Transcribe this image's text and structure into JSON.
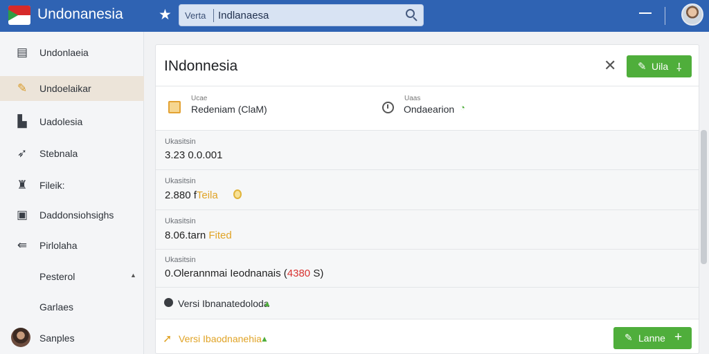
{
  "header": {
    "app_title": "Undonanesia",
    "search_prefix": "Verta",
    "search_value": "Indlanaesa",
    "icons": [
      "flag-icon",
      "star-icon",
      "search-icon",
      "minimize-icon",
      "avatar"
    ]
  },
  "sidebar": {
    "items": [
      {
        "label": "Undonlaeia",
        "icon": "inbox-icon"
      },
      {
        "label": "Undoelaikar",
        "icon": "pencil-icon",
        "active": true
      },
      {
        "label": "Uadolesia",
        "icon": "bookmark-icon"
      },
      {
        "label": "Stebnala",
        "icon": "wrench-icon"
      },
      {
        "label": "Fileik:",
        "icon": "puzzle-icon"
      },
      {
        "label": "Daddonsiohsighs",
        "icon": "clipboard-icon"
      },
      {
        "label": "Pirlolaha",
        "icon": "share-icon"
      },
      {
        "label": "Pesterol",
        "icon": ""
      },
      {
        "label": "Garlaes",
        "icon": ""
      },
      {
        "label": "Sanples",
        "icon": "avatar"
      }
    ]
  },
  "main": {
    "title": "INdonnesia",
    "edit_button": "Uila",
    "info": {
      "left_caption": "Ucae",
      "left_value": "Redeniam (ClaM)",
      "right_caption": "Uaas",
      "right_value": "Ondaearion"
    },
    "rows": [
      {
        "caption": "Ukasitsin",
        "value": "3.23 0.0.001",
        "tag": ""
      },
      {
        "caption": "Ukasitsin",
        "value": "2.880 f",
        "tag": "Teila"
      },
      {
        "caption": "Ukasitsin",
        "value": "8.06.tarn",
        "tag": "Fited"
      },
      {
        "caption": "Ukasitsin",
        "value": "0.Olerannmai Ieodnanais (",
        "tag": "4380",
        "suffix": " S)"
      }
    ],
    "version_line": "Versi Ibnanatedoloda",
    "footer_line": "Versi Ibaodnanehia",
    "learn_button": "Lanne"
  },
  "colors": {
    "topbar": "#2f63b3",
    "accent_green": "#4fae3b",
    "accent_yellow": "#e0a325",
    "accent_red": "#d8312f"
  }
}
